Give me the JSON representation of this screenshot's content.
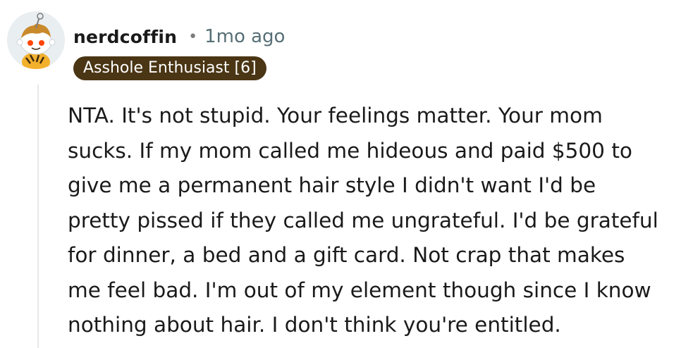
{
  "comment": {
    "username": "nerdcoffin",
    "separator": "•",
    "timestamp": "1mo ago",
    "flair": "Asshole Enthusiast [6]",
    "avatar_icon": "snoo-avatar-icon",
    "body_lines": [
      "NTA. It's not stupid. Your feelings matter. Your mom",
      "sucks. If my mom called me hideous and paid $500 to",
      "give me a permanent hair style I didn't want I'd be",
      "pretty pissed if they called me ungrateful. I'd be grateful",
      "for dinner, a bed and a gift card. Not crap that makes",
      "me feel bad. I'm out of my element though since I know",
      "nothing about hair. I don't think you're entitled."
    ]
  },
  "colors": {
    "flair_background": "#4a3514",
    "flair_text": "#ffffff",
    "username": "#1a1a1b",
    "timestamp": "#576f76",
    "thread_line": "#e6e8ea"
  }
}
